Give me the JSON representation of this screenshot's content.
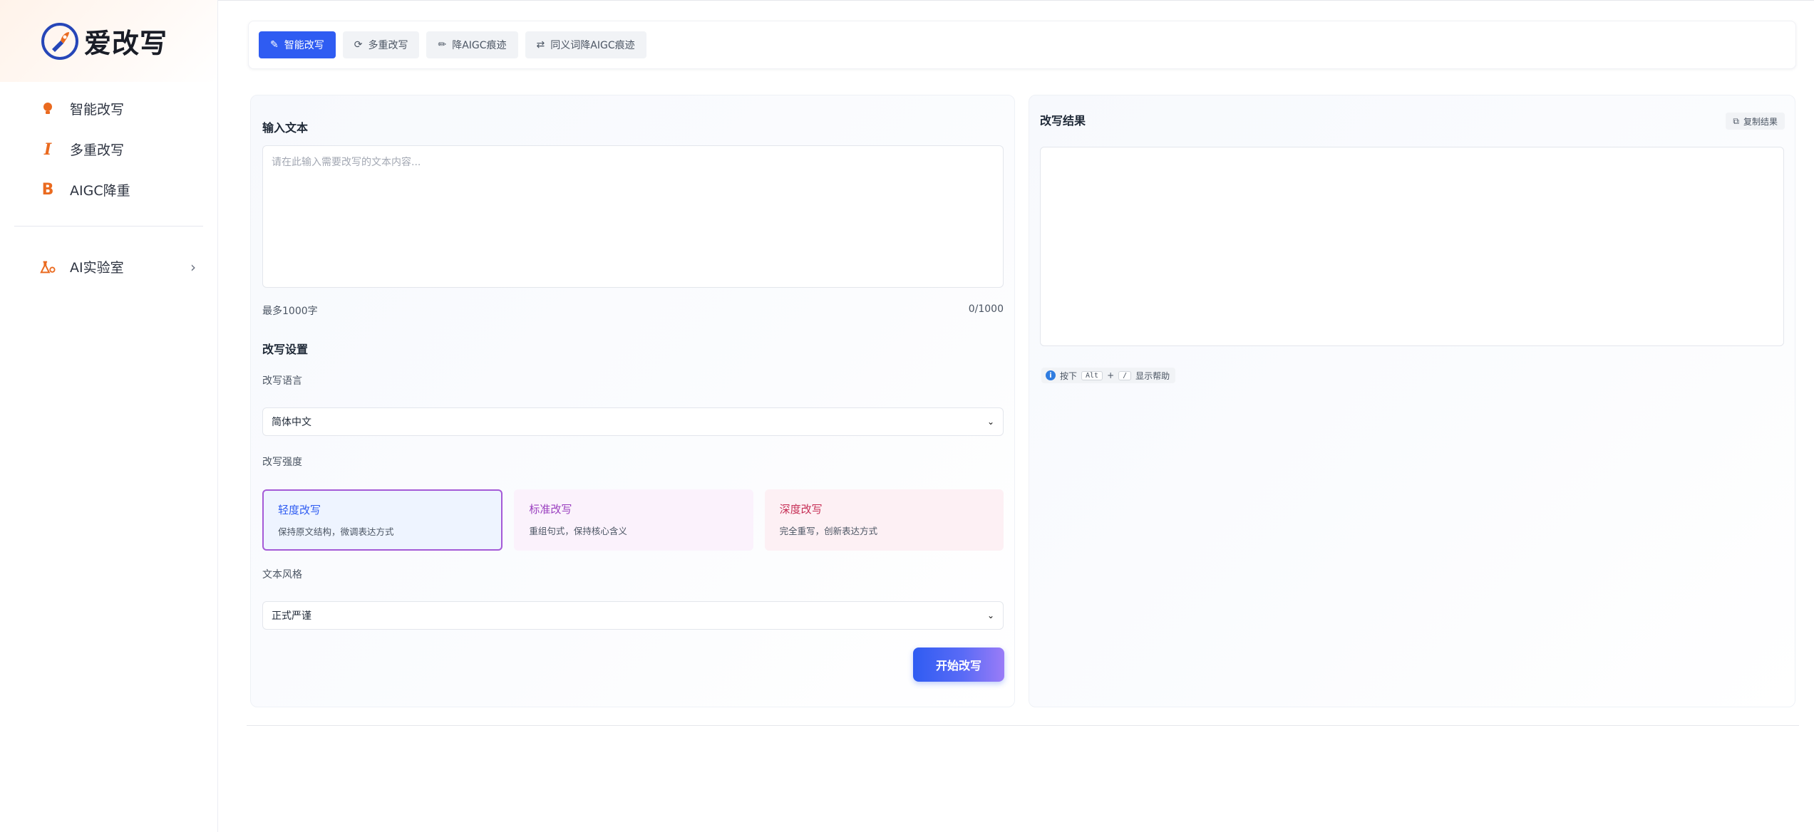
{
  "brand": {
    "name": "爱改写"
  },
  "sidebar": {
    "items": [
      {
        "label": "智能改写",
        "icon": "bulb-icon"
      },
      {
        "label": "多重改写",
        "icon": "italic-icon"
      },
      {
        "label": "AIGC降重",
        "icon": "bold-b-icon"
      }
    ],
    "lab": {
      "label": "AI实验室",
      "icon": "flask-icon"
    }
  },
  "toolbar": {
    "tabs": [
      {
        "label": "智能改写",
        "icon": "edit-icon",
        "active": true
      },
      {
        "label": "多重改写",
        "icon": "refresh-icon",
        "active": false
      },
      {
        "label": "降AIGC痕迹",
        "icon": "pencil-icon",
        "active": false
      },
      {
        "label": "同义词降AIGC痕迹",
        "icon": "swap-icon",
        "active": false
      }
    ]
  },
  "input": {
    "title": "输入文本",
    "placeholder": "请在此输入需要改写的文本内容...",
    "limit_text": "最多1000字",
    "counter": "0/1000"
  },
  "settings": {
    "title": "改写设置",
    "language_label": "改写语言",
    "language_value": "简体中文",
    "strength_label": "改写强度",
    "strengths": [
      {
        "title": "轻度改写",
        "desc": "保持原文结构，微调表达方式",
        "selected": true
      },
      {
        "title": "标准改写",
        "desc": "重组句式，保持核心含义",
        "selected": false
      },
      {
        "title": "深度改写",
        "desc": "完全重写，创新表达方式",
        "selected": false
      }
    ],
    "style_label": "文本风格",
    "style_value": "正式严谨",
    "start_button": "开始改写"
  },
  "result": {
    "title": "改写结果",
    "copy_button": "复制结果",
    "help": {
      "prefix": "按下",
      "key1": "Alt",
      "plus": "+",
      "key2": "/",
      "suffix": "显示帮助"
    }
  },
  "colors": {
    "accent": "#2f5cf2",
    "brand_orange": "#ea6a1f",
    "brand_navy": "#2646b8"
  }
}
